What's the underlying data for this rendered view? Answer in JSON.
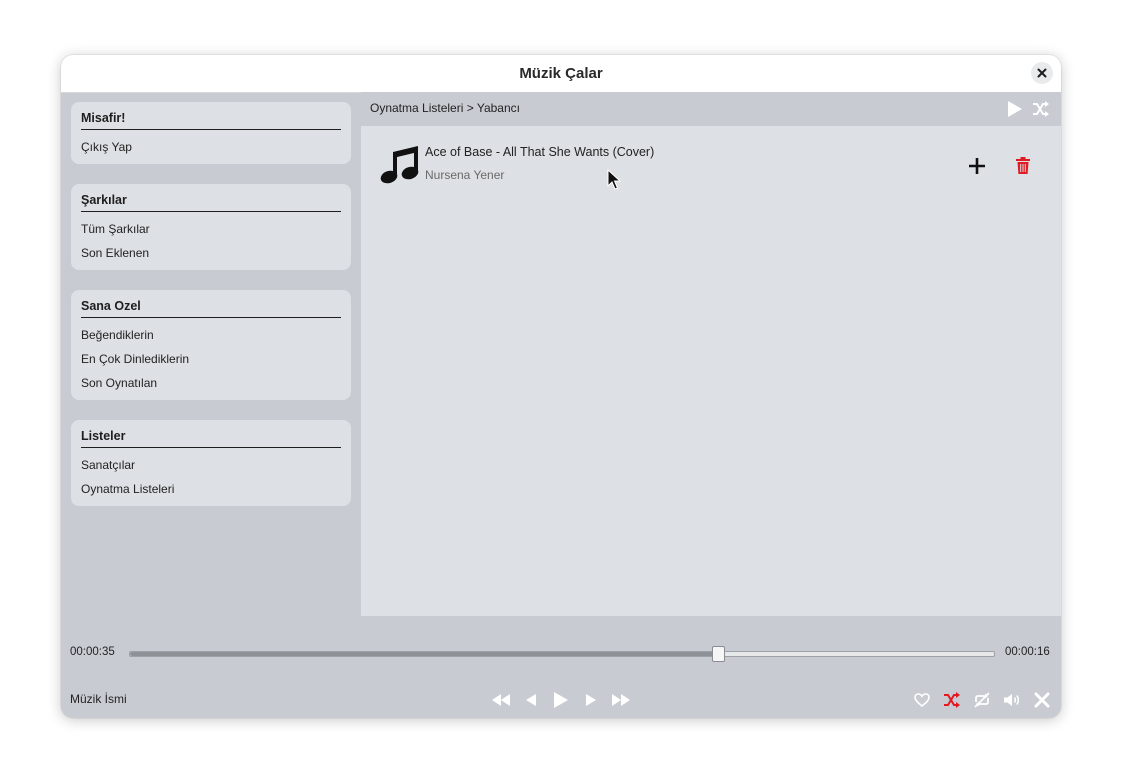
{
  "window": {
    "title": "Müzik Çalar"
  },
  "sidebar": {
    "user": {
      "title": "Misafir!",
      "items": [
        {
          "label": "Çıkış Yap"
        }
      ]
    },
    "songs": {
      "title": "Şarkılar",
      "items": [
        {
          "label": "Tüm Şarkılar"
        },
        {
          "label": "Son Eklenen"
        }
      ]
    },
    "for_you": {
      "title": "Sana Ozel",
      "items": [
        {
          "label": "Beğendiklerin"
        },
        {
          "label": "En Çok Dinlediklerin"
        },
        {
          "label": "Son Oynatılan"
        }
      ]
    },
    "lists": {
      "title": "Listeler",
      "items": [
        {
          "label": "Sanatçılar"
        },
        {
          "label": "Oynatma Listeleri"
        }
      ]
    }
  },
  "main": {
    "breadcrumb": "Oynatma Listeleri > Yabancı",
    "header_icons": [
      "play-icon",
      "shuffle-icon"
    ],
    "songs": [
      {
        "title": "Ace of Base - All That She Wants (Cover)",
        "artist": "Nursena Yener",
        "icon": "music-note-icon"
      }
    ]
  },
  "player": {
    "elapsed": "00:00:35",
    "remaining": "00:00:16",
    "progress": 0.68,
    "now_playing": "Müzik İsmi",
    "colors": {
      "accent": "#e01b24",
      "icon": "#ffffff",
      "text": "#1e1e1e"
    }
  }
}
